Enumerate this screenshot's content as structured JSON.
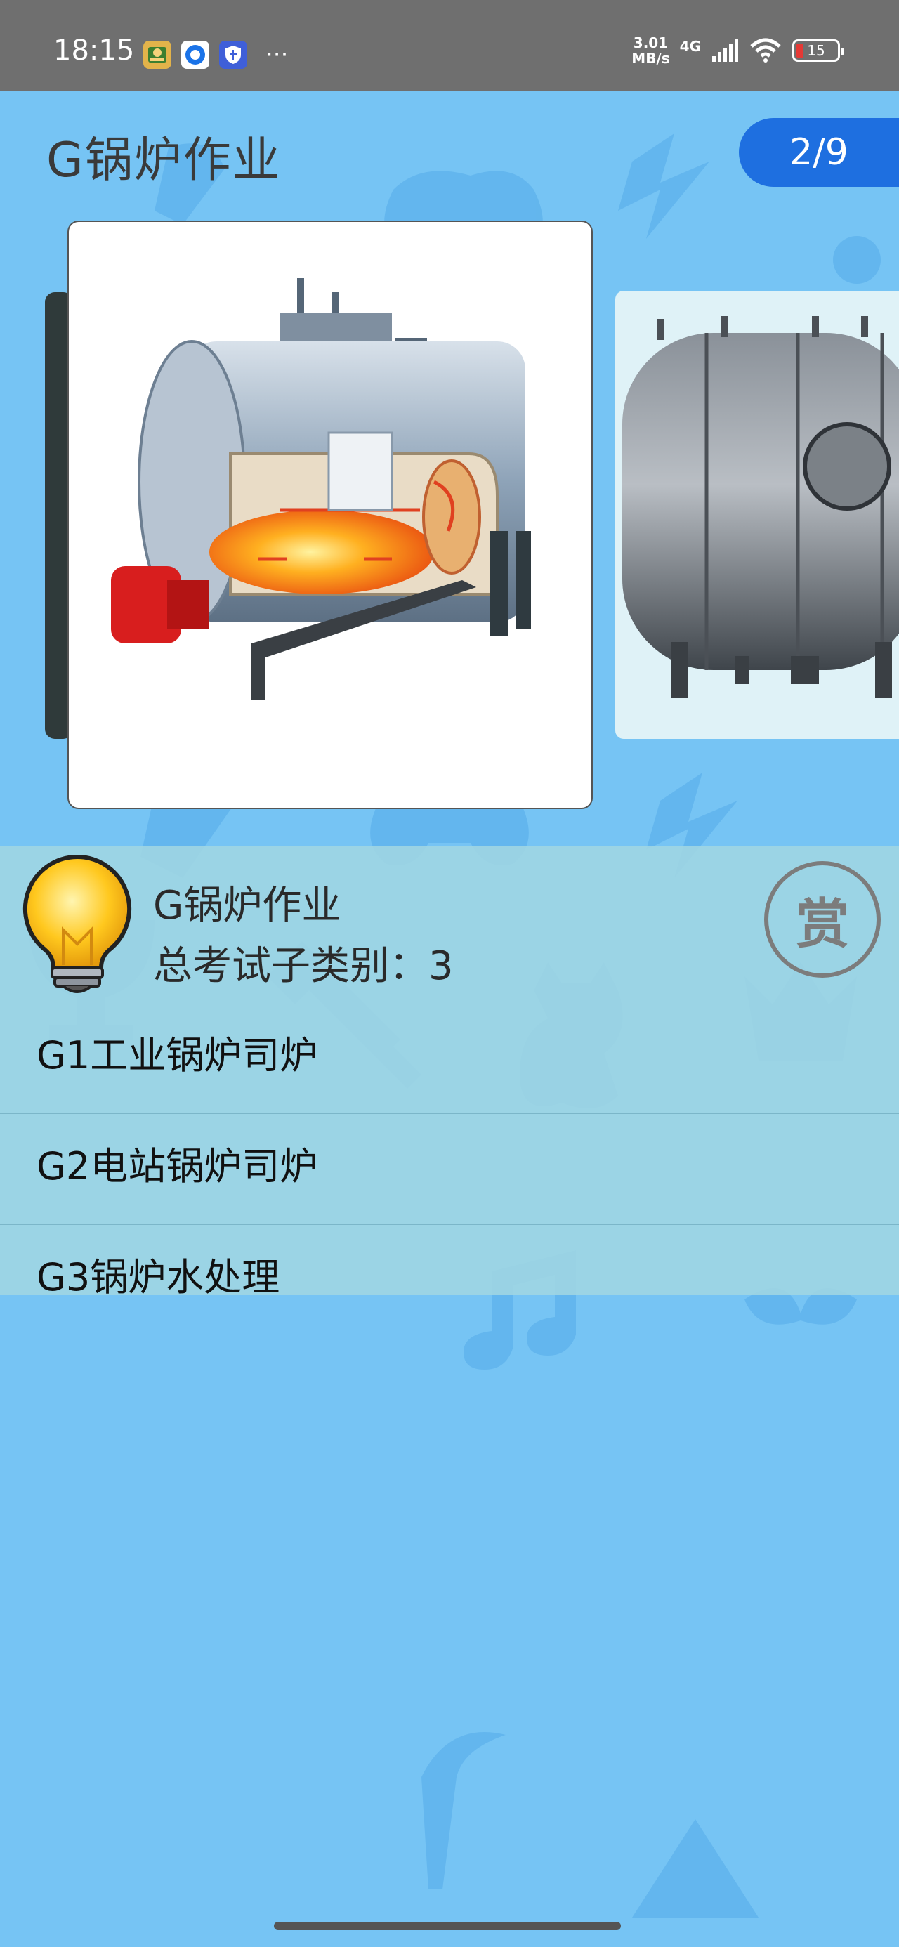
{
  "status_bar": {
    "time": "18:15",
    "net_speed_value": "3.01",
    "net_speed_unit": "MB/s",
    "network_type": "4G",
    "battery_level": "15",
    "more_indicator": "···",
    "icons": [
      "app-notification-icon",
      "chat-app-icon",
      "shield-app-icon",
      "signal-icon",
      "wifi-icon",
      "battery-icon"
    ]
  },
  "header": {
    "title": "G锅炉作业",
    "page_counter": "2/9"
  },
  "carousel": {
    "images": [
      "boiler-cutaway-image",
      "boiler-tank-image"
    ],
    "current_index": 2,
    "total": 9
  },
  "info": {
    "title": "G锅炉作业",
    "subtitle": "总考试子类别：3",
    "reward_label": "赏"
  },
  "categories": [
    {
      "label": "G1工业锅炉司炉"
    },
    {
      "label": "G2电站锅炉司炉"
    },
    {
      "label": "G3锅炉水处理"
    }
  ],
  "colors": {
    "background": "#76c4f4",
    "status_bar": "#6f6f6f",
    "counter_badge": "#1e6fe0",
    "panel": "#a0d6e2"
  }
}
